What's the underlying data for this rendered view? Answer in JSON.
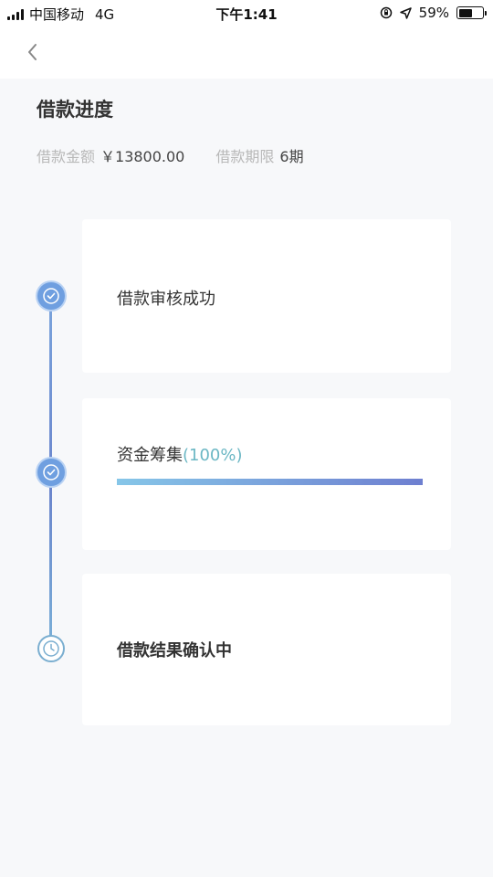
{
  "status_bar": {
    "carrier": "中国移动",
    "network": "4G",
    "time": "下午1:41",
    "battery": "59%",
    "battery_level": 0.59
  },
  "nav": {
    "back_icon": "chevron-left-icon"
  },
  "header": {
    "title": "借款进度",
    "amount_label": "借款金额",
    "amount_value": "￥13800.00",
    "term_label": "借款期限",
    "term_value": "6期"
  },
  "steps": [
    {
      "title": "借款审核成功",
      "status": "done",
      "icon": "check-circle-icon"
    },
    {
      "title": "资金筹集",
      "percent_text": "(100%)",
      "progress": 1.0,
      "status": "done",
      "icon": "check-circle-icon"
    },
    {
      "title": "借款结果确认中",
      "status": "pending",
      "icon": "clock-icon"
    }
  ],
  "colors": {
    "accent": "#6f9fe0",
    "percent": "#6bb7c4",
    "progress_start": "#86c6e8",
    "progress_end": "#6e7fd0"
  }
}
